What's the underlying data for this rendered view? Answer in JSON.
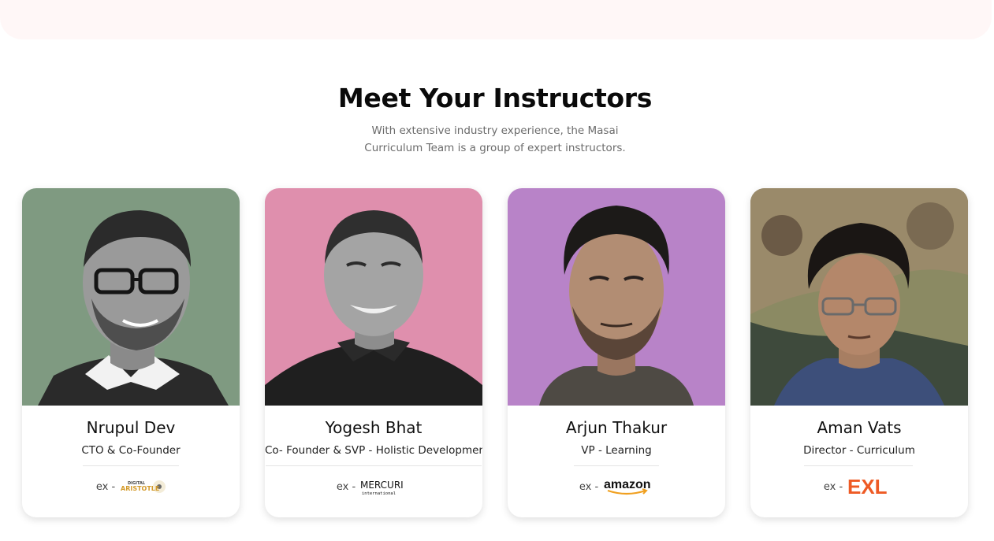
{
  "section": {
    "title": "Meet Your Instructors",
    "subtitle_line1": "With extensive industry experience, the Masai",
    "subtitle_line2": "Curriculum Team is a group of expert instructors."
  },
  "ex_prefix": "ex -",
  "instructors": [
    {
      "name": "Nrupul Dev",
      "role": "CTO & Co-Founder",
      "company_logo": "DIGITAL ARISTOTLE",
      "company_logo_top": "DIGITAL",
      "company_logo_main": "ARISTOTLE",
      "bg_color": "#7f9a81"
    },
    {
      "name": "Yogesh Bhat",
      "role": "Co- Founder & SVP - Holistic Development",
      "company_logo": "MERCURI international",
      "company_logo_main": "MERCURI",
      "company_logo_sub": "international",
      "bg_color": "#df8fad"
    },
    {
      "name": "Arjun Thakur",
      "role": "VP - Learning",
      "company_logo": "amazon",
      "bg_color": "#b883c8"
    },
    {
      "name": "Aman Vats",
      "role": "Director - Curriculum",
      "company_logo": "EXL",
      "bg_color": "#8b8a63"
    }
  ],
  "colors": {
    "amazon_smile": "#f0a020",
    "exl": "#ee5a24",
    "aristotle": "#d39a2a"
  }
}
